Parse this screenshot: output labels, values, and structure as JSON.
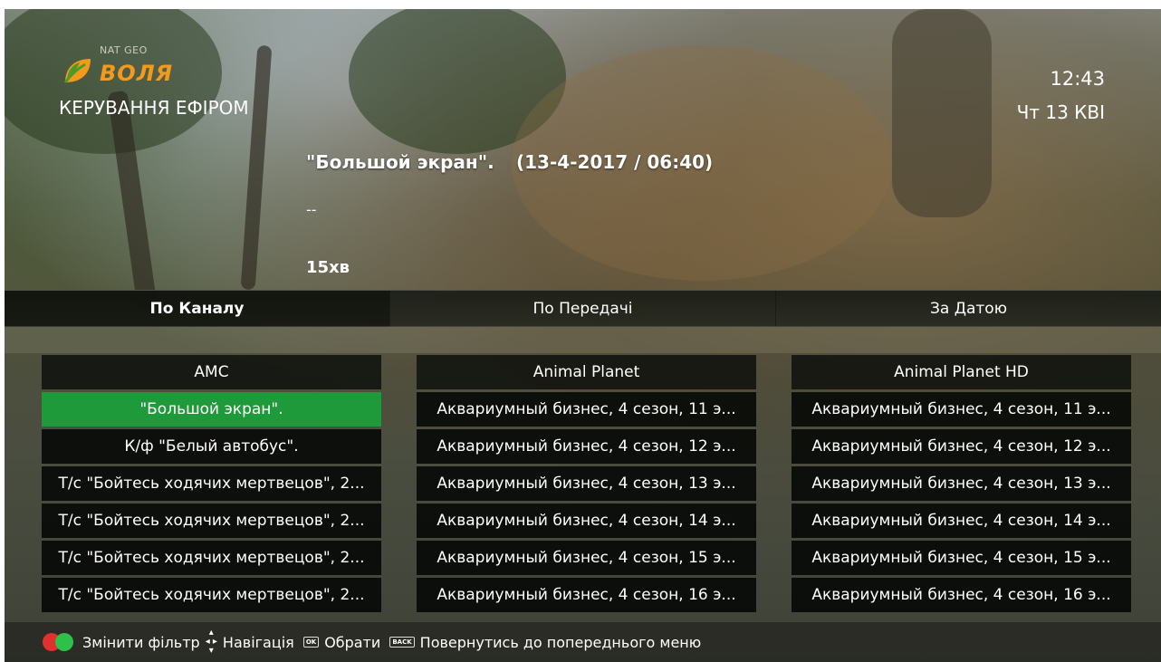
{
  "header": {
    "logo_small": "NAT GEO",
    "logo_brand": "ВОЛЯ",
    "title": "КЕРУВАННЯ ЕФІРОМ",
    "time": "12:43",
    "date": "Чт 13 КВІ"
  },
  "program": {
    "title": "\"Большой экран\".",
    "datetime": "(13-4-2017 / 06:40)",
    "description": "--",
    "duration": "15хв"
  },
  "tabs": [
    {
      "label": "По Каналу",
      "active": true
    },
    {
      "label": "По Передачі",
      "active": false
    },
    {
      "label": "За Датою",
      "active": false
    }
  ],
  "channels": [
    {
      "name": "AMC",
      "rows": [
        "\"Большой экран\".",
        "К/ф \"Белый автобус\".",
        "Т/с \"Бойтесь ходячих мертвецов\", 2...",
        "Т/с \"Бойтесь ходячих мертвецов\", 2...",
        "Т/с \"Бойтесь ходячих мертвецов\", 2...",
        "Т/с \"Бойтесь ходячих мертвецов\", 2..."
      ]
    },
    {
      "name": "Animal Planet",
      "rows": [
        "Аквариумный бизнес, 4 сезон, 11 э...",
        "Аквариумный бизнес, 4 сезон, 12 э...",
        "Аквариумный бизнес, 4 сезон, 13 э...",
        "Аквариумный бизнес, 4 сезон, 14 э...",
        "Аквариумный бизнес, 4 сезон, 15 э...",
        "Аквариумный бизнес, 4 сезон, 16 э..."
      ]
    },
    {
      "name": "Animal Planet HD",
      "rows": [
        "Аквариумный бизнес, 4 сезон, 11 э...",
        "Аквариумный бизнес, 4 сезон, 12 э...",
        "Аквариумный бизнес, 4 сезон, 13 э...",
        "Аквариумный бизнес, 4 сезон, 14 э...",
        "Аквариумный бизнес, 4 сезон, 15 э...",
        "Аквариумный бизнес, 4 сезон, 16 э..."
      ]
    }
  ],
  "selected": {
    "column": 0,
    "row": 0
  },
  "footer": {
    "filter_label": "Змінити фільтр",
    "nav_label": "Навігація",
    "ok_icon": "OK",
    "ok_label": "Обрати",
    "back_icon": "BACK",
    "back_label": "Повернутись до попереднього меню"
  },
  "colors": {
    "selected_row": "#1f9a3a",
    "brand": "#f39a1c",
    "red_button": "#e03030",
    "green_button": "#2ec04a"
  }
}
